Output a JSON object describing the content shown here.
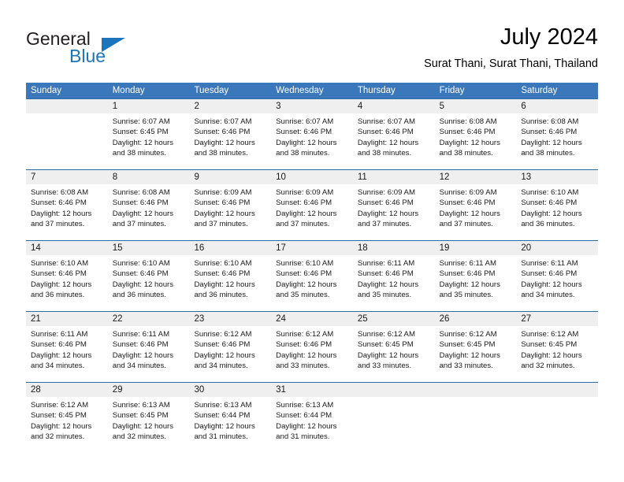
{
  "brand": {
    "logo_text_primary": "General",
    "logo_text_secondary": "Blue",
    "accent_color": "#1b75bb"
  },
  "header": {
    "title": "July 2024",
    "subtitle": "Surat Thani, Surat Thani, Thailand"
  },
  "calendar": {
    "header_background": "#3a77bb",
    "day_band_background": "#efefef",
    "row_border_color": "#2e6da4",
    "weekday_labels": [
      "Sunday",
      "Monday",
      "Tuesday",
      "Wednesday",
      "Thursday",
      "Friday",
      "Saturday"
    ],
    "weeks": [
      [
        {
          "day": "",
          "sunrise": "",
          "sunset": "",
          "daylight_line1": "",
          "daylight_line2": ""
        },
        {
          "day": "1",
          "sunrise": "Sunrise: 6:07 AM",
          "sunset": "Sunset: 6:45 PM",
          "daylight_line1": "Daylight: 12 hours",
          "daylight_line2": "and 38 minutes."
        },
        {
          "day": "2",
          "sunrise": "Sunrise: 6:07 AM",
          "sunset": "Sunset: 6:46 PM",
          "daylight_line1": "Daylight: 12 hours",
          "daylight_line2": "and 38 minutes."
        },
        {
          "day": "3",
          "sunrise": "Sunrise: 6:07 AM",
          "sunset": "Sunset: 6:46 PM",
          "daylight_line1": "Daylight: 12 hours",
          "daylight_line2": "and 38 minutes."
        },
        {
          "day": "4",
          "sunrise": "Sunrise: 6:07 AM",
          "sunset": "Sunset: 6:46 PM",
          "daylight_line1": "Daylight: 12 hours",
          "daylight_line2": "and 38 minutes."
        },
        {
          "day": "5",
          "sunrise": "Sunrise: 6:08 AM",
          "sunset": "Sunset: 6:46 PM",
          "daylight_line1": "Daylight: 12 hours",
          "daylight_line2": "and 38 minutes."
        },
        {
          "day": "6",
          "sunrise": "Sunrise: 6:08 AM",
          "sunset": "Sunset: 6:46 PM",
          "daylight_line1": "Daylight: 12 hours",
          "daylight_line2": "and 38 minutes."
        }
      ],
      [
        {
          "day": "7",
          "sunrise": "Sunrise: 6:08 AM",
          "sunset": "Sunset: 6:46 PM",
          "daylight_line1": "Daylight: 12 hours",
          "daylight_line2": "and 37 minutes."
        },
        {
          "day": "8",
          "sunrise": "Sunrise: 6:08 AM",
          "sunset": "Sunset: 6:46 PM",
          "daylight_line1": "Daylight: 12 hours",
          "daylight_line2": "and 37 minutes."
        },
        {
          "day": "9",
          "sunrise": "Sunrise: 6:09 AM",
          "sunset": "Sunset: 6:46 PM",
          "daylight_line1": "Daylight: 12 hours",
          "daylight_line2": "and 37 minutes."
        },
        {
          "day": "10",
          "sunrise": "Sunrise: 6:09 AM",
          "sunset": "Sunset: 6:46 PM",
          "daylight_line1": "Daylight: 12 hours",
          "daylight_line2": "and 37 minutes."
        },
        {
          "day": "11",
          "sunrise": "Sunrise: 6:09 AM",
          "sunset": "Sunset: 6:46 PM",
          "daylight_line1": "Daylight: 12 hours",
          "daylight_line2": "and 37 minutes."
        },
        {
          "day": "12",
          "sunrise": "Sunrise: 6:09 AM",
          "sunset": "Sunset: 6:46 PM",
          "daylight_line1": "Daylight: 12 hours",
          "daylight_line2": "and 37 minutes."
        },
        {
          "day": "13",
          "sunrise": "Sunrise: 6:10 AM",
          "sunset": "Sunset: 6:46 PM",
          "daylight_line1": "Daylight: 12 hours",
          "daylight_line2": "and 36 minutes."
        }
      ],
      [
        {
          "day": "14",
          "sunrise": "Sunrise: 6:10 AM",
          "sunset": "Sunset: 6:46 PM",
          "daylight_line1": "Daylight: 12 hours",
          "daylight_line2": "and 36 minutes."
        },
        {
          "day": "15",
          "sunrise": "Sunrise: 6:10 AM",
          "sunset": "Sunset: 6:46 PM",
          "daylight_line1": "Daylight: 12 hours",
          "daylight_line2": "and 36 minutes."
        },
        {
          "day": "16",
          "sunrise": "Sunrise: 6:10 AM",
          "sunset": "Sunset: 6:46 PM",
          "daylight_line1": "Daylight: 12 hours",
          "daylight_line2": "and 36 minutes."
        },
        {
          "day": "17",
          "sunrise": "Sunrise: 6:10 AM",
          "sunset": "Sunset: 6:46 PM",
          "daylight_line1": "Daylight: 12 hours",
          "daylight_line2": "and 35 minutes."
        },
        {
          "day": "18",
          "sunrise": "Sunrise: 6:11 AM",
          "sunset": "Sunset: 6:46 PM",
          "daylight_line1": "Daylight: 12 hours",
          "daylight_line2": "and 35 minutes."
        },
        {
          "day": "19",
          "sunrise": "Sunrise: 6:11 AM",
          "sunset": "Sunset: 6:46 PM",
          "daylight_line1": "Daylight: 12 hours",
          "daylight_line2": "and 35 minutes."
        },
        {
          "day": "20",
          "sunrise": "Sunrise: 6:11 AM",
          "sunset": "Sunset: 6:46 PM",
          "daylight_line1": "Daylight: 12 hours",
          "daylight_line2": "and 34 minutes."
        }
      ],
      [
        {
          "day": "21",
          "sunrise": "Sunrise: 6:11 AM",
          "sunset": "Sunset: 6:46 PM",
          "daylight_line1": "Daylight: 12 hours",
          "daylight_line2": "and 34 minutes."
        },
        {
          "day": "22",
          "sunrise": "Sunrise: 6:11 AM",
          "sunset": "Sunset: 6:46 PM",
          "daylight_line1": "Daylight: 12 hours",
          "daylight_line2": "and 34 minutes."
        },
        {
          "day": "23",
          "sunrise": "Sunrise: 6:12 AM",
          "sunset": "Sunset: 6:46 PM",
          "daylight_line1": "Daylight: 12 hours",
          "daylight_line2": "and 34 minutes."
        },
        {
          "day": "24",
          "sunrise": "Sunrise: 6:12 AM",
          "sunset": "Sunset: 6:46 PM",
          "daylight_line1": "Daylight: 12 hours",
          "daylight_line2": "and 33 minutes."
        },
        {
          "day": "25",
          "sunrise": "Sunrise: 6:12 AM",
          "sunset": "Sunset: 6:45 PM",
          "daylight_line1": "Daylight: 12 hours",
          "daylight_line2": "and 33 minutes."
        },
        {
          "day": "26",
          "sunrise": "Sunrise: 6:12 AM",
          "sunset": "Sunset: 6:45 PM",
          "daylight_line1": "Daylight: 12 hours",
          "daylight_line2": "and 33 minutes."
        },
        {
          "day": "27",
          "sunrise": "Sunrise: 6:12 AM",
          "sunset": "Sunset: 6:45 PM",
          "daylight_line1": "Daylight: 12 hours",
          "daylight_line2": "and 32 minutes."
        }
      ],
      [
        {
          "day": "28",
          "sunrise": "Sunrise: 6:12 AM",
          "sunset": "Sunset: 6:45 PM",
          "daylight_line1": "Daylight: 12 hours",
          "daylight_line2": "and 32 minutes."
        },
        {
          "day": "29",
          "sunrise": "Sunrise: 6:13 AM",
          "sunset": "Sunset: 6:45 PM",
          "daylight_line1": "Daylight: 12 hours",
          "daylight_line2": "and 32 minutes."
        },
        {
          "day": "30",
          "sunrise": "Sunrise: 6:13 AM",
          "sunset": "Sunset: 6:44 PM",
          "daylight_line1": "Daylight: 12 hours",
          "daylight_line2": "and 31 minutes."
        },
        {
          "day": "31",
          "sunrise": "Sunrise: 6:13 AM",
          "sunset": "Sunset: 6:44 PM",
          "daylight_line1": "Daylight: 12 hours",
          "daylight_line2": "and 31 minutes."
        },
        {
          "day": "",
          "sunrise": "",
          "sunset": "",
          "daylight_line1": "",
          "daylight_line2": ""
        },
        {
          "day": "",
          "sunrise": "",
          "sunset": "",
          "daylight_line1": "",
          "daylight_line2": ""
        },
        {
          "day": "",
          "sunrise": "",
          "sunset": "",
          "daylight_line1": "",
          "daylight_line2": ""
        }
      ]
    ]
  }
}
